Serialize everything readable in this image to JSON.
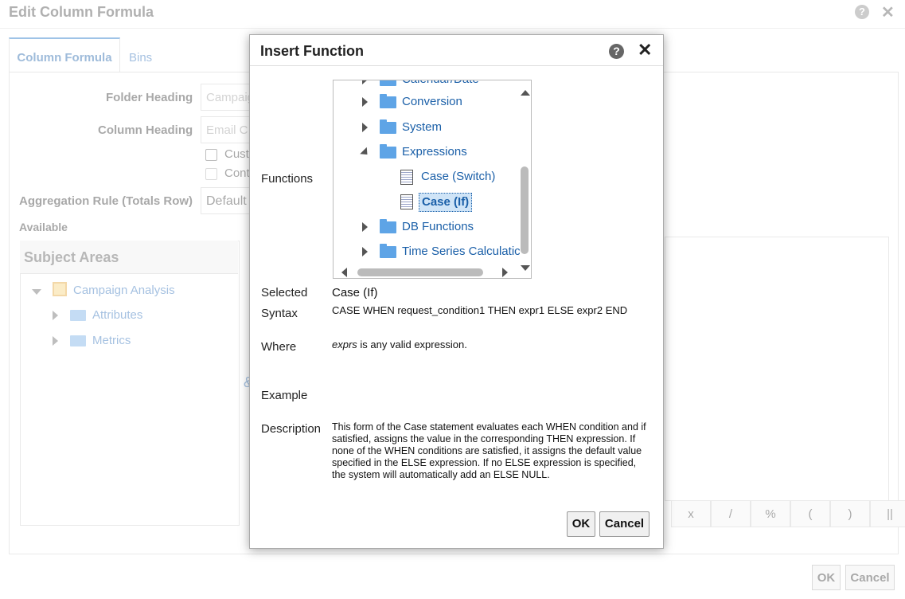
{
  "background": {
    "title": "Edit Column Formula",
    "tabs": [
      {
        "label": "Column Formula"
      },
      {
        "label": "Bins"
      }
    ],
    "folder_heading_label": "Folder Heading",
    "folder_heading_value": "Campaig",
    "column_heading_label": "Column Heading",
    "column_heading_value": "Email C",
    "checkbox1_label": "Cust",
    "checkbox2_label": "Cont",
    "aggregation_label": "Aggregation Rule (Totals Row)",
    "aggregation_value": "Default (",
    "available_label": "Available",
    "subject_areas_title": "Subject Areas",
    "subject_tree": [
      {
        "label": "Campaign Analysis"
      },
      {
        "label": "Attributes"
      },
      {
        "label": "Metrics"
      }
    ],
    "operators": [
      "x",
      "/",
      "%",
      "(",
      ")",
      "||"
    ],
    "ok_label": "OK",
    "cancel_label": "Cancel"
  },
  "dialog": {
    "title": "Insert Function",
    "help_icon": "question-circle-icon",
    "close_icon": "close-icon",
    "functions_label": "Functions",
    "tree": [
      {
        "label": "Calendar/Date",
        "type": "folder",
        "state": "collapsed"
      },
      {
        "label": "Conversion",
        "type": "folder",
        "state": "collapsed"
      },
      {
        "label": "System",
        "type": "folder",
        "state": "collapsed"
      },
      {
        "label": "Expressions",
        "type": "folder",
        "state": "expanded"
      },
      {
        "label": "Case (Switch)",
        "type": "function"
      },
      {
        "label": "Case (If)",
        "type": "function",
        "selected": true
      },
      {
        "label": "DB Functions",
        "type": "folder",
        "state": "collapsed"
      },
      {
        "label": "Time Series Calculatic",
        "type": "folder",
        "state": "collapsed"
      }
    ],
    "selected_label": "Selected",
    "selected_value": "Case (If)",
    "syntax_label": "Syntax",
    "syntax_value": "CASE WHEN request_condition1 THEN expr1 ELSE expr2 END",
    "where_label": "Where",
    "where_term": "exprs",
    "where_value": " is any valid expression.",
    "example_label": "Example",
    "description_label": "Description",
    "description_value": "This form of the Case statement evaluates each WHEN condition and if satisfied, assigns the value in the corresponding THEN expression. If none of the WHEN conditions are satisfied, it assigns the default value specified in the ELSE expression. If no ELSE expression is specified, the system will automatically add an ELSE NULL.",
    "ok_label": "OK",
    "cancel_label": "Cancel"
  },
  "colors": {
    "link_blue": "#1a5fa8",
    "folder_blue": "#5ea4e6",
    "selection_bg": "#cfe4f7"
  }
}
